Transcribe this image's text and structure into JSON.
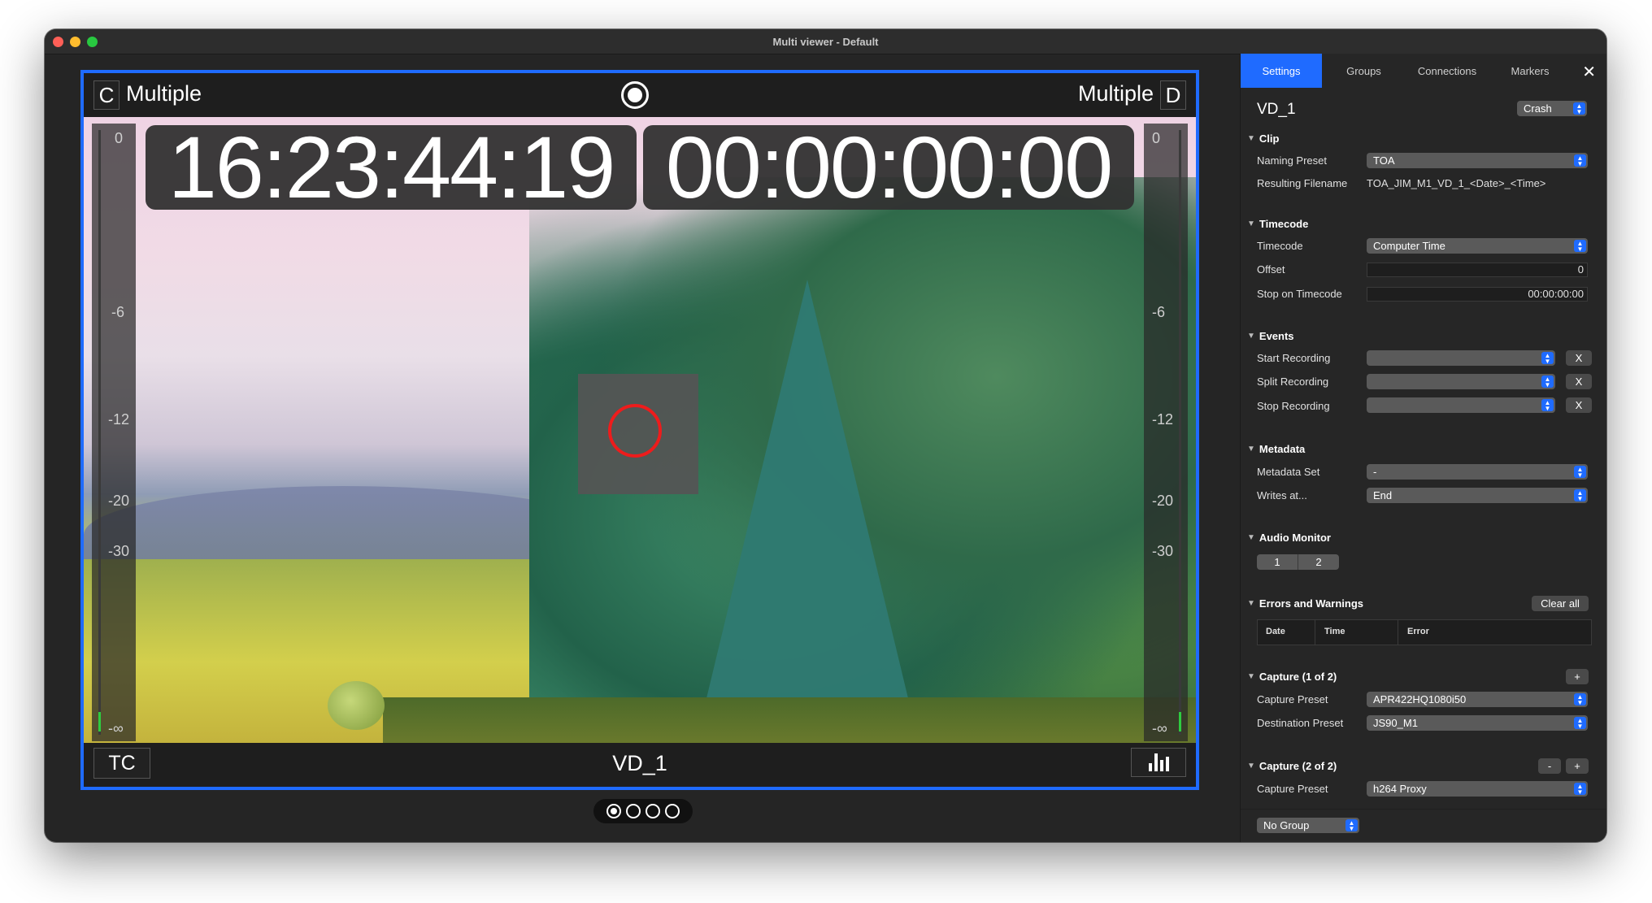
{
  "window": {
    "title": "Multi viewer - Default"
  },
  "viewer": {
    "left_channel": {
      "letter": "C",
      "label": "Multiple"
    },
    "right_channel": {
      "letter": "D",
      "label": "Multiple"
    },
    "timecode_current": "16:23:44:19",
    "timecode_elapsed": "00:00:00:00",
    "meter_ticks": [
      "0",
      "-6",
      "-12",
      "-20",
      "-30",
      "-∞"
    ],
    "bottom": {
      "tc_label": "TC",
      "clip_name": "VD_1"
    },
    "pager": {
      "pages": 4,
      "active": 0
    }
  },
  "panel": {
    "tabs": [
      {
        "label": "Settings",
        "active": true
      },
      {
        "label": "Groups",
        "active": false
      },
      {
        "label": "Connections",
        "active": false
      },
      {
        "label": "Markers",
        "active": false
      }
    ],
    "close_label": "✕",
    "clip_title": "VD_1",
    "crash_select": "Crash",
    "sections": {
      "clip": {
        "title": "Clip",
        "naming_preset_label": "Naming Preset",
        "naming_preset_value": "TOA",
        "resulting_filename_label": "Resulting Filename",
        "resulting_filename_value": "TOA_JIM_M1_VD_1_<Date>_<Time>"
      },
      "timecode": {
        "title": "Timecode",
        "timecode_label": "Timecode",
        "timecode_value": "Computer Time",
        "offset_label": "Offset",
        "offset_value": "0",
        "stop_label": "Stop on Timecode",
        "stop_value": "00:00:00:00"
      },
      "events": {
        "title": "Events",
        "start_label": "Start Recording",
        "split_label": "Split Recording",
        "stop_label": "Stop Recording",
        "clear_label": "X"
      },
      "metadata": {
        "title": "Metadata",
        "set_label": "Metadata Set",
        "set_value": "-",
        "writes_label": "Writes at...",
        "writes_value": "End"
      },
      "audio_monitor": {
        "title": "Audio Monitor",
        "channels": [
          "1",
          "2"
        ]
      },
      "errors": {
        "title": "Errors and Warnings",
        "clear_all_label": "Clear all",
        "columns": [
          "Date",
          "Time",
          "Error"
        ]
      },
      "capture1": {
        "title": "Capture (1 of 2)",
        "add_label": "+",
        "preset_label": "Capture Preset",
        "preset_value": "APR422HQ1080i50",
        "dest_label": "Destination Preset",
        "dest_value": "JS90_M1"
      },
      "capture2": {
        "title": "Capture (2 of 2)",
        "remove_label": "-",
        "add_label": "+",
        "preset_label": "Capture Preset",
        "preset_value": "h264 Proxy"
      }
    },
    "footer": {
      "group_select": "No Group"
    }
  },
  "colors": {
    "accent": "#1f6bff",
    "record": "#ee1c1c",
    "meter_green": "#2ecc40"
  }
}
